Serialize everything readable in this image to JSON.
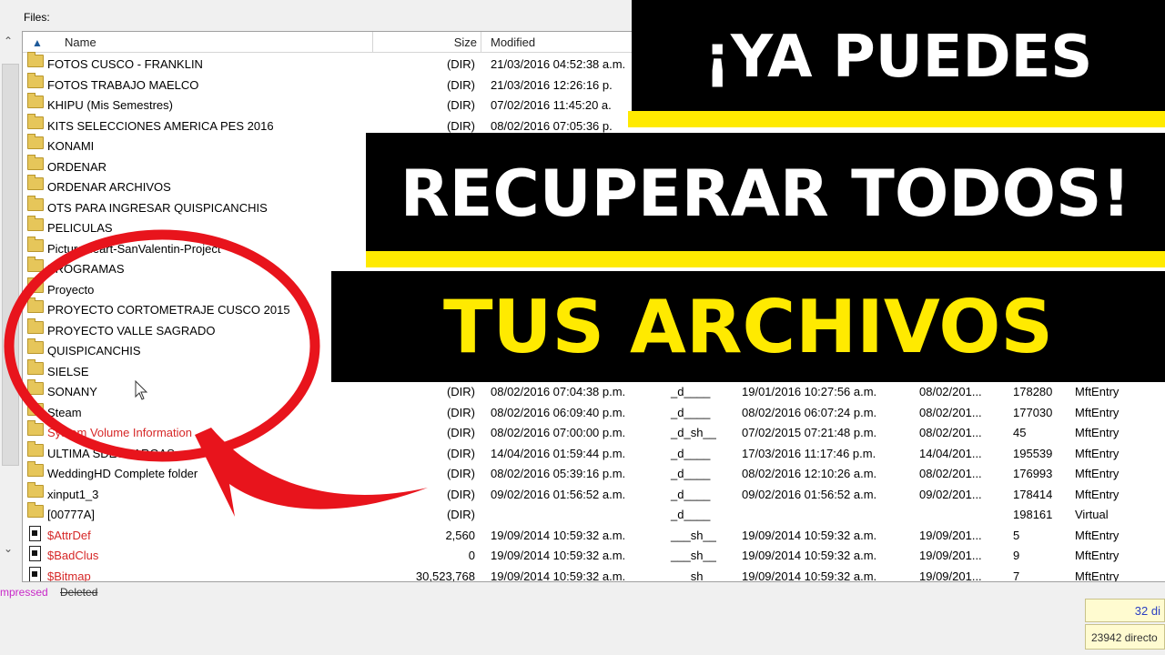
{
  "files_label": "Files:",
  "columns": {
    "name": "Name",
    "size": "Size",
    "modified": "Modified"
  },
  "rows": [
    {
      "name": "FOTOS CUSCO - FRANKLIN",
      "size": "(DIR)",
      "modified": "21/03/2016 04:52:38 a.m.",
      "attr": "",
      "created": "",
      "accessed": "",
      "id": "",
      "type": "",
      "kind": "folder",
      "red": false
    },
    {
      "name": "FOTOS TRABAJO MAELCO",
      "size": "(DIR)",
      "modified": "21/03/2016 12:26:16 p.",
      "attr": "",
      "created": "",
      "accessed": "",
      "id": "",
      "type": "",
      "kind": "folder",
      "red": false
    },
    {
      "name": "KHIPU (Mis Semestres)",
      "size": "(DIR)",
      "modified": "07/02/2016 11:45:20 a.",
      "attr": "",
      "created": "",
      "accessed": "",
      "id": "",
      "type": "",
      "kind": "folder",
      "red": false
    },
    {
      "name": "KITS SELECCIONES AMERICA PES 2016",
      "size": "(DIR)",
      "modified": "08/02/2016 07:05:36 p.",
      "attr": "",
      "created": "",
      "accessed": "",
      "id": "",
      "type": "",
      "kind": "folder",
      "red": false
    },
    {
      "name": "KONAMI",
      "size": "",
      "modified": "",
      "attr": "",
      "created": "",
      "accessed": "",
      "id": "",
      "type": "",
      "kind": "folder",
      "red": false
    },
    {
      "name": "ORDENAR",
      "size": "",
      "modified": "",
      "attr": "",
      "created": "",
      "accessed": "",
      "id": "",
      "type": "",
      "kind": "folder",
      "red": false
    },
    {
      "name": "ORDENAR ARCHIVOS",
      "size": "",
      "modified": "",
      "attr": "",
      "created": "",
      "accessed": "",
      "id": "",
      "type": "",
      "kind": "folder",
      "red": false
    },
    {
      "name": "OTS PARA INGRESAR QUISPICANCHIS",
      "size": "",
      "modified": "",
      "attr": "",
      "created": "",
      "accessed": "",
      "id": "",
      "type": "",
      "kind": "folder",
      "red": false
    },
    {
      "name": "PELICULAS",
      "size": "",
      "modified": "",
      "attr": "",
      "created": "",
      "accessed": "",
      "id": "",
      "type": "",
      "kind": "folder",
      "red": false
    },
    {
      "name": "PictureHeart-SanValentin-Project",
      "size": "",
      "modified": "",
      "attr": "",
      "created": "",
      "accessed": "",
      "id": "",
      "type": "",
      "kind": "folder",
      "red": false
    },
    {
      "name": "PROGRAMAS",
      "size": "",
      "modified": "",
      "attr": "",
      "created": "",
      "accessed": "",
      "id": "",
      "type": "",
      "kind": "folder",
      "red": false
    },
    {
      "name": "Proyecto",
      "size": "",
      "modified": "",
      "attr": "",
      "created": "",
      "accessed": "",
      "id": "",
      "type": "",
      "kind": "folder",
      "red": false
    },
    {
      "name": "PROYECTO CORTOMETRAJE CUSCO 2015",
      "size": "",
      "modified": "",
      "attr": "",
      "created": "",
      "accessed": "",
      "id": "",
      "type": "",
      "kind": "folder",
      "red": false
    },
    {
      "name": "PROYECTO VALLE SAGRADO",
      "size": "",
      "modified": "",
      "attr": "",
      "created": "",
      "accessed": "",
      "id": "",
      "type": "",
      "kind": "folder",
      "red": false
    },
    {
      "name": "QUISPICANCHIS",
      "size": "",
      "modified": "",
      "attr": "",
      "created": "",
      "accessed": "",
      "id": "",
      "type": "",
      "kind": "folder",
      "red": false
    },
    {
      "name": "SIELSE",
      "size": "",
      "modified": "",
      "attr": "",
      "created": "",
      "accessed": "",
      "id": "",
      "type": "",
      "kind": "folder",
      "red": false
    },
    {
      "name": "SONANY",
      "size": "(DIR)",
      "modified": "08/02/2016 07:04:38 p.m.",
      "attr": "_d____",
      "created": "19/01/2016 10:27:56 a.m.",
      "accessed": "08/02/201...",
      "id": "178280",
      "type": "MftEntry",
      "kind": "folder",
      "red": false
    },
    {
      "name": "Steam",
      "size": "(DIR)",
      "modified": "08/02/2016 06:09:40 p.m.",
      "attr": "_d____",
      "created": "08/02/2016 06:07:24 p.m.",
      "accessed": "08/02/201...",
      "id": "177030",
      "type": "MftEntry",
      "kind": "folder",
      "red": false
    },
    {
      "name": "System Volume Information",
      "size": "(DIR)",
      "modified": "08/02/2016 07:00:00 p.m.",
      "attr": "_d_sh__",
      "created": "07/02/2015 07:21:48 p.m.",
      "accessed": "08/02/201...",
      "id": "45",
      "type": "MftEntry",
      "kind": "folder",
      "red": true
    },
    {
      "name": "ULTIMA SDESCARGAS",
      "size": "(DIR)",
      "modified": "14/04/2016 01:59:44 p.m.",
      "attr": "_d____",
      "created": "17/03/2016 11:17:46 p.m.",
      "accessed": "14/04/201...",
      "id": "195539",
      "type": "MftEntry",
      "kind": "folder",
      "red": false
    },
    {
      "name": "WeddingHD Complete folder",
      "size": "(DIR)",
      "modified": "08/02/2016 05:39:16 p.m.",
      "attr": "_d____",
      "created": "08/02/2016 12:10:26 a.m.",
      "accessed": "08/02/201...",
      "id": "176993",
      "type": "MftEntry",
      "kind": "folder",
      "red": false
    },
    {
      "name": "xinput1_3",
      "size": "(DIR)",
      "modified": "09/02/2016 01:56:52 a.m.",
      "attr": "_d____",
      "created": "09/02/2016 01:56:52 a.m.",
      "accessed": "09/02/201...",
      "id": "178414",
      "type": "MftEntry",
      "kind": "folder",
      "red": false
    },
    {
      "name": "[00777A]",
      "size": "(DIR)",
      "modified": "",
      "attr": "_d____",
      "created": "",
      "accessed": "",
      "id": "198161",
      "type": "Virtual",
      "kind": "folder",
      "red": false
    },
    {
      "name": "$AttrDef",
      "size": "2,560",
      "modified": "19/09/2014 10:59:32 a.m.",
      "attr": "___sh__",
      "created": "19/09/2014 10:59:32 a.m.",
      "accessed": "19/09/201...",
      "id": "5",
      "type": "MftEntry",
      "kind": "file",
      "red": true
    },
    {
      "name": "$BadClus",
      "size": "0",
      "modified": "19/09/2014 10:59:32 a.m.",
      "attr": "___sh__",
      "created": "19/09/2014 10:59:32 a.m.",
      "accessed": "19/09/201...",
      "id": "9",
      "type": "MftEntry",
      "kind": "file",
      "red": true
    },
    {
      "name": "$Bitmap",
      "size": "30,523,768",
      "modified": "19/09/2014 10:59:32 a.m.",
      "attr": "___sh__",
      "created": "19/09/2014 10:59:32 a.m.",
      "accessed": "19/09/201...",
      "id": "7",
      "type": "MftEntry",
      "kind": "file",
      "red": true
    }
  ],
  "status": {
    "compressed": "mpressed",
    "deleted": "Deleted"
  },
  "summary": {
    "dirs": "32 di",
    "directories": "23942 directo"
  },
  "banner": {
    "line1": "¡YA PUEDES",
    "line2": "RECUPERAR TODOS!",
    "line3": "TUS ARCHIVOS"
  },
  "colors": {
    "highlight_red": "#e8141c",
    "banner_yellow": "#ffea00",
    "compressed_text": "#c828c8",
    "deleted_text": "#333333"
  }
}
